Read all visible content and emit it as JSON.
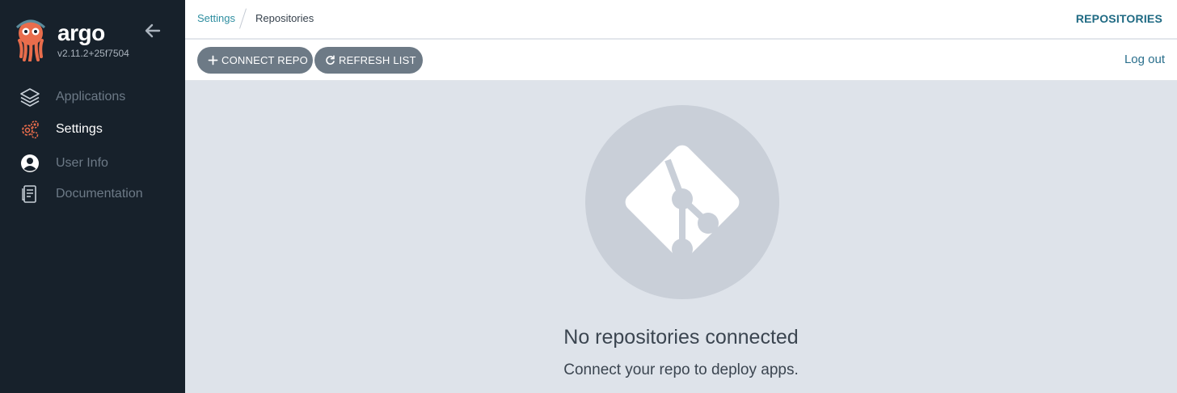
{
  "app": {
    "brand": "argo",
    "version": "v2.11.2+25f7504"
  },
  "sidebar": {
    "items": [
      {
        "label": "Applications",
        "icon": "layers-icon",
        "active": false
      },
      {
        "label": "Settings",
        "icon": "gears-icon",
        "active": true
      },
      {
        "label": "User Info",
        "icon": "user-circle-icon",
        "active": false
      },
      {
        "label": "Documentation",
        "icon": "book-icon",
        "active": false
      }
    ]
  },
  "breadcrumb": {
    "parent": "Settings",
    "current": "Repositories"
  },
  "header": {
    "title": "REPOSITORIES"
  },
  "toolbar": {
    "connect_label": "CONNECT REPO",
    "refresh_label": "REFRESH LIST",
    "logout_label": "Log out"
  },
  "empty_state": {
    "icon": "git-icon",
    "title": "No repositories connected",
    "subtitle": "Connect your repo to deploy apps."
  },
  "colors": {
    "sidebar_bg": "#17212b",
    "accent_orange": "#e96d4c",
    "button_bg": "#6d7a86",
    "content_bg": "#dee3ea",
    "link": "#2e8ea0"
  }
}
